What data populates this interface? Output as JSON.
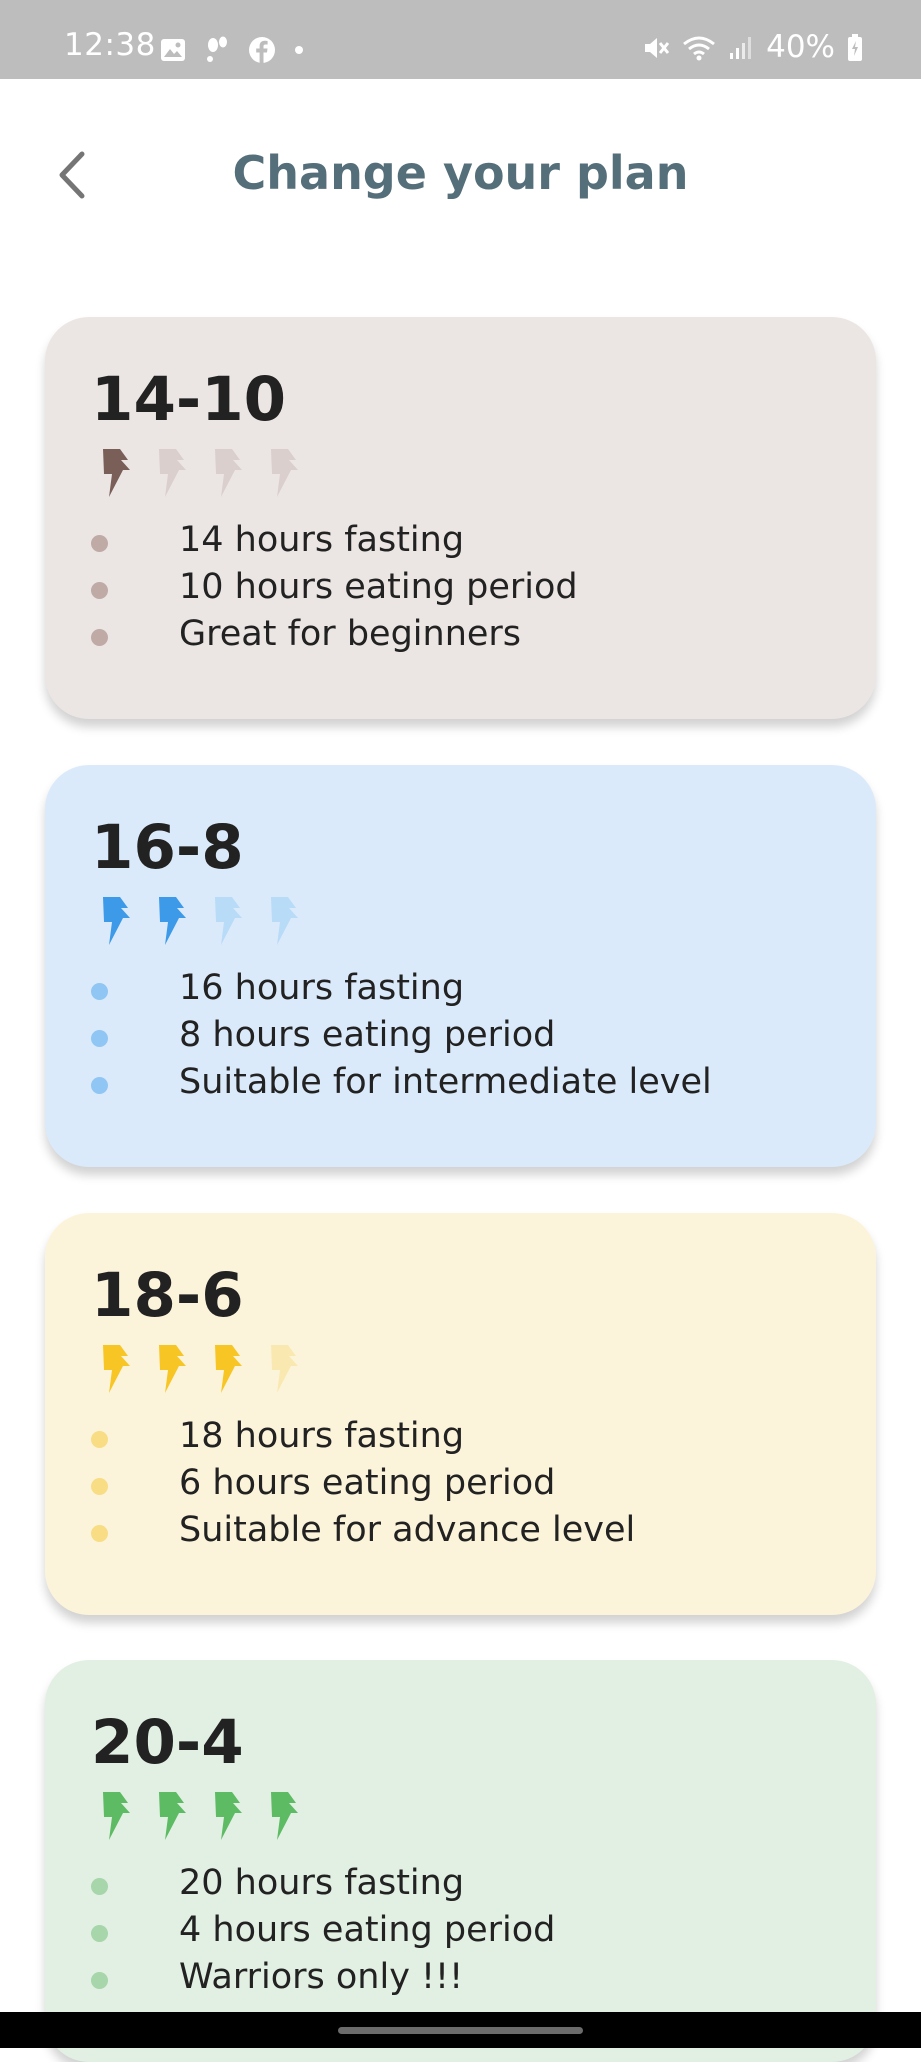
{
  "status_bar": {
    "time": "12:38",
    "battery": "40%",
    "left_icons": [
      "gallery-icon",
      "fitness-icon",
      "facebook-icon",
      "dot-icon"
    ],
    "right_icons": [
      "mute-icon",
      "wifi-icon",
      "signal-icon",
      "battery-icon"
    ]
  },
  "header": {
    "title": "Change your plan",
    "back_icon": "chevron-left-icon"
  },
  "plans": [
    {
      "name": "14-10",
      "level": 1,
      "features": [
        "14 hours fasting",
        "10 hours eating period",
        "Great for beginners"
      ],
      "colors": {
        "background": "#ebe6e4",
        "bolt_active": "#7a5f58",
        "bolt_inactive": "#dacfcc",
        "dot": "#bfaaa5"
      }
    },
    {
      "name": "16-8",
      "level": 2,
      "features": [
        "16 hours fasting",
        "8 hours eating period",
        "Suitable for intermediate level"
      ],
      "colors": {
        "background": "#dbeafa",
        "bolt_active": "#3c9ae8",
        "bolt_inactive": "#b8dbf8",
        "dot": "#90c6f3"
      }
    },
    {
      "name": "18-6",
      "level": 3,
      "features": [
        "18 hours fasting",
        "6 hours eating period",
        "Suitable for advance level"
      ],
      "colors": {
        "background": "#fcf4da",
        "bolt_active": "#f7c625",
        "bolt_inactive": "#f9e9b1",
        "dot": "#f8dd84"
      }
    },
    {
      "name": "20-4",
      "level": 4,
      "features": [
        "20 hours fasting",
        "4 hours eating period",
        "Warriors only !!!"
      ],
      "colors": {
        "background": "#e2efe3",
        "bolt_active": "#5cbb63",
        "bolt_inactive": "#bfe2c2",
        "dot": "#a6d6aa"
      }
    }
  ]
}
